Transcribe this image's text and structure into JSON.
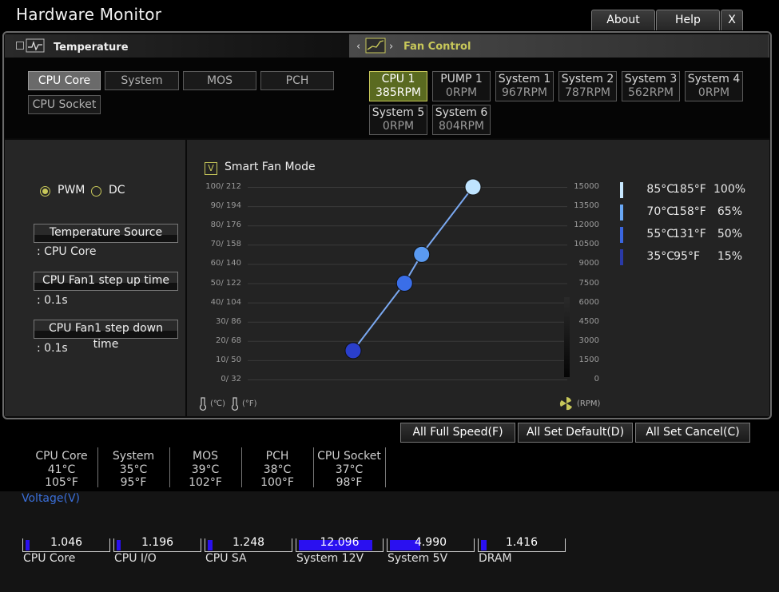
{
  "app": {
    "title": "Hardware Monitor"
  },
  "window_buttons": {
    "about": "About",
    "help": "Help",
    "close": "X"
  },
  "tabs": {
    "temperature": "Temperature",
    "fan_control": "Fan Control",
    "prev": "‹",
    "next": "›"
  },
  "temp_sources": [
    "CPU Core",
    "System",
    "MOS",
    "PCH",
    "CPU Socket"
  ],
  "fans": [
    {
      "name": "CPU 1",
      "rpm": "385RPM",
      "active": true
    },
    {
      "name": "PUMP 1",
      "rpm": "0RPM"
    },
    {
      "name": "System 1",
      "rpm": "967RPM"
    },
    {
      "name": "System 2",
      "rpm": "787RPM"
    },
    {
      "name": "System 3",
      "rpm": "562RPM"
    },
    {
      "name": "System 4",
      "rpm": "0RPM"
    },
    {
      "name": "System 5",
      "rpm": "0RPM"
    },
    {
      "name": "System 6",
      "rpm": "804RPM"
    }
  ],
  "mode": {
    "pwm": "PWM",
    "dc": "DC",
    "selected": "PWM"
  },
  "settings": {
    "temperature_source_label": "Temperature Source",
    "temperature_source_value": ": CPU Core",
    "step_up_label": "CPU Fan1 step up time",
    "step_up_value": ": 0.1s",
    "step_down_label": "CPU Fan1 step down time",
    "step_down_value": ": 0.1s"
  },
  "smart_fan": {
    "checkbox": "V",
    "label": "Smart Fan Mode",
    "checked": true
  },
  "graph": {
    "left_ticks": [
      "100/ 212",
      "90/ 194",
      "80/ 176",
      "70/ 158",
      "60/ 140",
      "50/ 122",
      "40/ 104",
      "30/ 86",
      "20/ 68",
      "10/ 50",
      "0/ 32"
    ],
    "right_ticks": [
      "15000",
      "13500",
      "12000",
      "10500",
      "9000",
      "7500",
      "6000",
      "4500",
      "3000",
      "1500",
      "0"
    ],
    "unit_c": "(℃)",
    "unit_f": "(°F)",
    "unit_rpm": "(RPM)",
    "points": [
      {
        "temp_c": 20,
        "percent": 15,
        "color": "#2a3fcc"
      },
      {
        "temp_c": 50,
        "percent": 50,
        "color": "#3a6ee8"
      },
      {
        "temp_c": 60,
        "percent": 65,
        "color": "#5a9af0"
      },
      {
        "temp_c": 90,
        "percent": 100,
        "color": "#bfe4ff"
      }
    ]
  },
  "legend": [
    {
      "c": "85°C",
      "f": "185°F",
      "pct": "100%",
      "color": "#c8e8ff"
    },
    {
      "c": "70°C",
      "f": "158°F",
      "pct": "65%",
      "color": "#6aa8f5"
    },
    {
      "c": "55°C",
      "f": "131°F",
      "pct": "50%",
      "color": "#3a66e0"
    },
    {
      "c": "35°C",
      "f": "95°F",
      "pct": "15%",
      "color": "#2a3aa8"
    }
  ],
  "actions": {
    "full_speed": "All Full Speed(F)",
    "set_default": "All Set Default(D)",
    "set_cancel": "All Set Cancel(C)"
  },
  "temps": [
    {
      "name": "CPU Core",
      "c": "41°C",
      "f": "105°F"
    },
    {
      "name": "System",
      "c": "35°C",
      "f": "95°F"
    },
    {
      "name": "MOS",
      "c": "39°C",
      "f": "102°F"
    },
    {
      "name": "PCH",
      "c": "38°C",
      "f": "100°F"
    },
    {
      "name": "CPU Socket",
      "c": "37°C",
      "f": "98°F"
    }
  ],
  "voltage": {
    "title": "Voltage(V)",
    "items": [
      {
        "name": "CPU Core",
        "value": "1.046",
        "fill": 0.05
      },
      {
        "name": "CPU I/O",
        "value": "1.196",
        "fill": 0.05
      },
      {
        "name": "CPU SA",
        "value": "1.248",
        "fill": 0.06
      },
      {
        "name": "System 12V",
        "value": "12.096",
        "fill": 0.92
      },
      {
        "name": "System 5V",
        "value": "4.990",
        "fill": 0.38
      },
      {
        "name": "DRAM",
        "value": "1.416",
        "fill": 0.07
      }
    ]
  }
}
